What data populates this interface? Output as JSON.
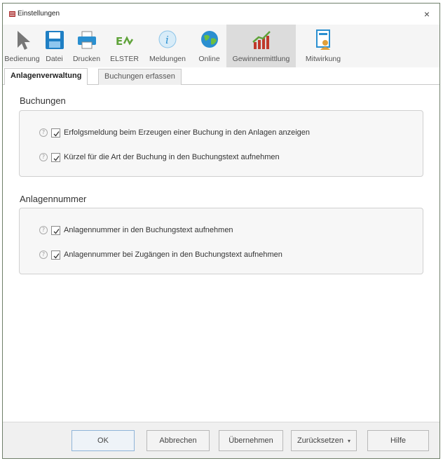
{
  "window": {
    "title": "Einstellungen",
    "close_glyph": "×"
  },
  "toolbar": {
    "items": [
      {
        "label": "Bedienung",
        "icon": "cursor-icon"
      },
      {
        "label": "Datei",
        "icon": "save-disk-icon"
      },
      {
        "label": "Drucken",
        "icon": "printer-icon"
      },
      {
        "label": "ELSTER",
        "icon": "elster-icon"
      },
      {
        "label": "Meldungen",
        "icon": "info-icon"
      },
      {
        "label": "Online",
        "icon": "globe-icon"
      },
      {
        "label": "Gewinnermittlung",
        "icon": "chart-icon",
        "active": true
      },
      {
        "label": "Mitwirkung",
        "icon": "user-document-icon"
      }
    ]
  },
  "subtabs": [
    {
      "label": "Anlagenverwaltung",
      "active": true
    },
    {
      "label": "Buchungen erfassen",
      "active": false
    }
  ],
  "sections": [
    {
      "title": "Buchungen",
      "options": [
        {
          "label": "Erfolgsmeldung beim Erzeugen einer Buchung in den Anlagen anzeigen",
          "checked": true
        },
        {
          "label": "Kürzel für die Art der Buchung in den Buchungstext aufnehmen",
          "checked": true
        }
      ]
    },
    {
      "title": "Anlagennummer",
      "options": [
        {
          "label": "Anlagennummer in den Buchungstext aufnehmen",
          "checked": true
        },
        {
          "label": "Anlagennummer bei Zugängen in den Buchungstext aufnehmen",
          "checked": true
        }
      ]
    }
  ],
  "help_glyph": "?",
  "buttons": {
    "ok": "OK",
    "cancel": "Abbrechen",
    "apply": "Übernehmen",
    "reset": "Zurücksetzen",
    "reset_caret": "▾",
    "help": "Hilfe"
  },
  "colors": {
    "toolbar_bg": "#f5f5f5",
    "active_tool_bg": "#dcdcdc",
    "group_bg": "#f7f7f7",
    "accent_green": "#5fa33a",
    "accent_blue": "#2a8fd0"
  }
}
